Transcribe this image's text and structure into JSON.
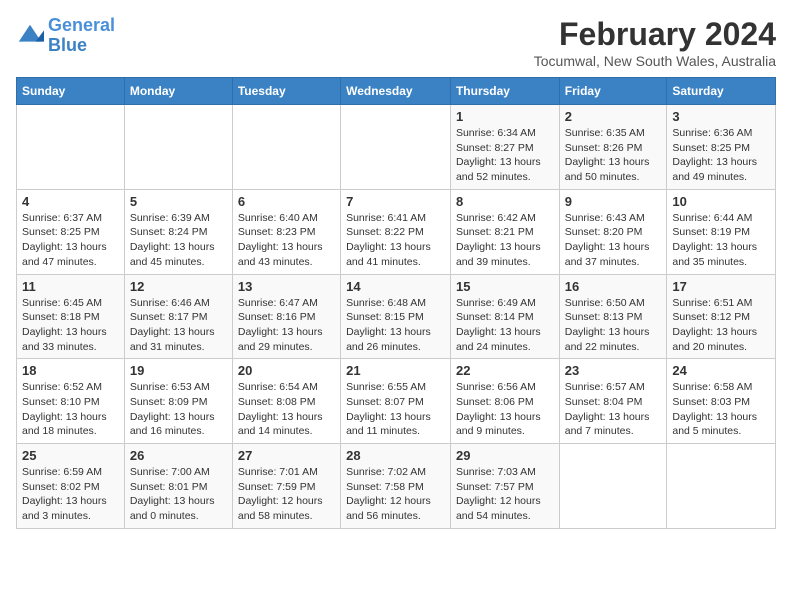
{
  "logo": {
    "line1": "General",
    "line2": "Blue"
  },
  "title": {
    "month_year": "February 2024",
    "location": "Tocumwal, New South Wales, Australia"
  },
  "headers": [
    "Sunday",
    "Monday",
    "Tuesday",
    "Wednesday",
    "Thursday",
    "Friday",
    "Saturday"
  ],
  "weeks": [
    [
      {
        "day": "",
        "info": ""
      },
      {
        "day": "",
        "info": ""
      },
      {
        "day": "",
        "info": ""
      },
      {
        "day": "",
        "info": ""
      },
      {
        "day": "1",
        "info": "Sunrise: 6:34 AM\nSunset: 8:27 PM\nDaylight: 13 hours\nand 52 minutes."
      },
      {
        "day": "2",
        "info": "Sunrise: 6:35 AM\nSunset: 8:26 PM\nDaylight: 13 hours\nand 50 minutes."
      },
      {
        "day": "3",
        "info": "Sunrise: 6:36 AM\nSunset: 8:25 PM\nDaylight: 13 hours\nand 49 minutes."
      }
    ],
    [
      {
        "day": "4",
        "info": "Sunrise: 6:37 AM\nSunset: 8:25 PM\nDaylight: 13 hours\nand 47 minutes."
      },
      {
        "day": "5",
        "info": "Sunrise: 6:39 AM\nSunset: 8:24 PM\nDaylight: 13 hours\nand 45 minutes."
      },
      {
        "day": "6",
        "info": "Sunrise: 6:40 AM\nSunset: 8:23 PM\nDaylight: 13 hours\nand 43 minutes."
      },
      {
        "day": "7",
        "info": "Sunrise: 6:41 AM\nSunset: 8:22 PM\nDaylight: 13 hours\nand 41 minutes."
      },
      {
        "day": "8",
        "info": "Sunrise: 6:42 AM\nSunset: 8:21 PM\nDaylight: 13 hours\nand 39 minutes."
      },
      {
        "day": "9",
        "info": "Sunrise: 6:43 AM\nSunset: 8:20 PM\nDaylight: 13 hours\nand 37 minutes."
      },
      {
        "day": "10",
        "info": "Sunrise: 6:44 AM\nSunset: 8:19 PM\nDaylight: 13 hours\nand 35 minutes."
      }
    ],
    [
      {
        "day": "11",
        "info": "Sunrise: 6:45 AM\nSunset: 8:18 PM\nDaylight: 13 hours\nand 33 minutes."
      },
      {
        "day": "12",
        "info": "Sunrise: 6:46 AM\nSunset: 8:17 PM\nDaylight: 13 hours\nand 31 minutes."
      },
      {
        "day": "13",
        "info": "Sunrise: 6:47 AM\nSunset: 8:16 PM\nDaylight: 13 hours\nand 29 minutes."
      },
      {
        "day": "14",
        "info": "Sunrise: 6:48 AM\nSunset: 8:15 PM\nDaylight: 13 hours\nand 26 minutes."
      },
      {
        "day": "15",
        "info": "Sunrise: 6:49 AM\nSunset: 8:14 PM\nDaylight: 13 hours\nand 24 minutes."
      },
      {
        "day": "16",
        "info": "Sunrise: 6:50 AM\nSunset: 8:13 PM\nDaylight: 13 hours\nand 22 minutes."
      },
      {
        "day": "17",
        "info": "Sunrise: 6:51 AM\nSunset: 8:12 PM\nDaylight: 13 hours\nand 20 minutes."
      }
    ],
    [
      {
        "day": "18",
        "info": "Sunrise: 6:52 AM\nSunset: 8:10 PM\nDaylight: 13 hours\nand 18 minutes."
      },
      {
        "day": "19",
        "info": "Sunrise: 6:53 AM\nSunset: 8:09 PM\nDaylight: 13 hours\nand 16 minutes."
      },
      {
        "day": "20",
        "info": "Sunrise: 6:54 AM\nSunset: 8:08 PM\nDaylight: 13 hours\nand 14 minutes."
      },
      {
        "day": "21",
        "info": "Sunrise: 6:55 AM\nSunset: 8:07 PM\nDaylight: 13 hours\nand 11 minutes."
      },
      {
        "day": "22",
        "info": "Sunrise: 6:56 AM\nSunset: 8:06 PM\nDaylight: 13 hours\nand 9 minutes."
      },
      {
        "day": "23",
        "info": "Sunrise: 6:57 AM\nSunset: 8:04 PM\nDaylight: 13 hours\nand 7 minutes."
      },
      {
        "day": "24",
        "info": "Sunrise: 6:58 AM\nSunset: 8:03 PM\nDaylight: 13 hours\nand 5 minutes."
      }
    ],
    [
      {
        "day": "25",
        "info": "Sunrise: 6:59 AM\nSunset: 8:02 PM\nDaylight: 13 hours\nand 3 minutes."
      },
      {
        "day": "26",
        "info": "Sunrise: 7:00 AM\nSunset: 8:01 PM\nDaylight: 13 hours\nand 0 minutes."
      },
      {
        "day": "27",
        "info": "Sunrise: 7:01 AM\nSunset: 7:59 PM\nDaylight: 12 hours\nand 58 minutes."
      },
      {
        "day": "28",
        "info": "Sunrise: 7:02 AM\nSunset: 7:58 PM\nDaylight: 12 hours\nand 56 minutes."
      },
      {
        "day": "29",
        "info": "Sunrise: 7:03 AM\nSunset: 7:57 PM\nDaylight: 12 hours\nand 54 minutes."
      },
      {
        "day": "",
        "info": ""
      },
      {
        "day": "",
        "info": ""
      }
    ]
  ]
}
